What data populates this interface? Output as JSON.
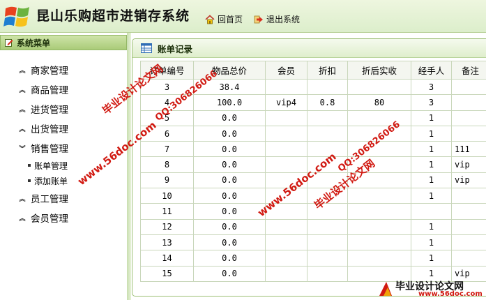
{
  "app": {
    "title": "昆山乐购超市进销存系统"
  },
  "nav": {
    "home": "回首页",
    "exit": "退出系统"
  },
  "sidebar": {
    "header": "系统菜单",
    "items": [
      {
        "label": "商家管理",
        "expanded": false
      },
      {
        "label": "商品管理",
        "expanded": false
      },
      {
        "label": "进货管理",
        "expanded": false
      },
      {
        "label": "出货管理",
        "expanded": false
      },
      {
        "label": "销售管理",
        "expanded": true
      },
      {
        "label": "员工管理",
        "expanded": false
      },
      {
        "label": "会员管理",
        "expanded": false
      }
    ],
    "sub_items": [
      "账单管理",
      "添加账单"
    ]
  },
  "panel": {
    "title": "账单记录"
  },
  "table": {
    "headers": [
      "订单编号",
      "物品总价",
      "会员",
      "折扣",
      "折后实收",
      "经手人",
      "备注"
    ],
    "rows": [
      [
        "3",
        "38.4",
        "",
        "",
        "",
        "3",
        ""
      ],
      [
        "4",
        "100.0",
        "vip4",
        "0.8",
        "80",
        "3",
        ""
      ],
      [
        "5",
        "0.0",
        "",
        "",
        "",
        "1",
        ""
      ],
      [
        "6",
        "0.0",
        "",
        "",
        "",
        "1",
        ""
      ],
      [
        "7",
        "0.0",
        "",
        "",
        "",
        "1",
        "111"
      ],
      [
        "8",
        "0.0",
        "",
        "",
        "",
        "1",
        "vip"
      ],
      [
        "9",
        "0.0",
        "",
        "",
        "",
        "1",
        "vip"
      ],
      [
        "10",
        "0.0",
        "",
        "",
        "",
        "1",
        ""
      ],
      [
        "11",
        "0.0",
        "",
        "",
        "",
        "",
        ""
      ],
      [
        "12",
        "0.0",
        "",
        "",
        "",
        "1",
        ""
      ],
      [
        "13",
        "0.0",
        "",
        "",
        "",
        "1",
        ""
      ],
      [
        "14",
        "0.0",
        "",
        "",
        "",
        "1",
        ""
      ],
      [
        "15",
        "0.0",
        "",
        "",
        "",
        "1",
        "vip"
      ]
    ]
  },
  "watermarks": {
    "site_name": "毕业设计论文网",
    "url": "www.56doc.com",
    "qq": "QQ:306826066"
  },
  "colors": {
    "accent": "#a9cb78",
    "watermark": "#d11a12"
  }
}
